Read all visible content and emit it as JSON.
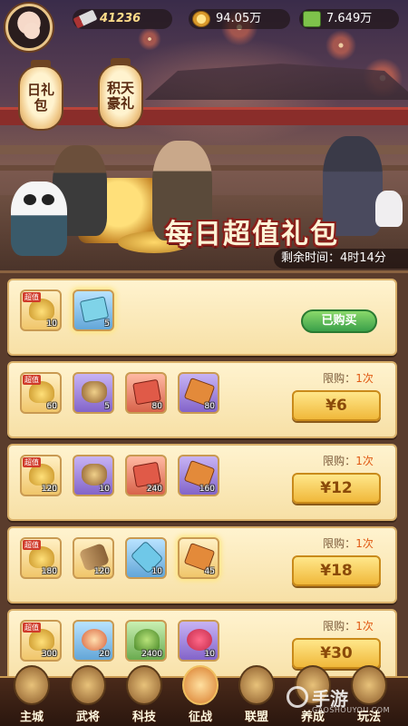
{
  "header": {
    "power": "41236",
    "gold": "94.05万",
    "food": "7.649万"
  },
  "lanterns": [
    {
      "label": "日礼包"
    },
    {
      "label": "积天豪礼"
    }
  ],
  "banner": {
    "title": "每日超值礼包",
    "timer": "剩余时间：4时14分"
  },
  "packages": [
    {
      "items": [
        {
          "icon": "gold-ingot-icon",
          "count": "10",
          "tag": "超值",
          "bg": "gold"
        },
        {
          "icon": "ticket-icon",
          "count": "5",
          "tag": "",
          "bg": "blue"
        }
      ],
      "limit_label": "",
      "limit_num": "",
      "button": "已购买",
      "bought": true
    },
    {
      "items": [
        {
          "icon": "gold-ingot-icon",
          "count": "60",
          "tag": "超值",
          "bg": "gold"
        },
        {
          "icon": "bag-icon",
          "count": "5",
          "tag": "",
          "bg": "purple"
        },
        {
          "icon": "red-envelope-icon",
          "count": "80",
          "tag": "",
          "bg": "red"
        },
        {
          "icon": "scroll-icon",
          "count": "80",
          "tag": "",
          "bg": "purple"
        }
      ],
      "limit_label": "限购：",
      "limit_num": "1次",
      "button": "¥6",
      "bought": false
    },
    {
      "items": [
        {
          "icon": "gold-ingot-icon",
          "count": "120",
          "tag": "超值",
          "bg": "gold"
        },
        {
          "icon": "bag-icon",
          "count": "10",
          "tag": "",
          "bg": "purple"
        },
        {
          "icon": "red-envelope-icon",
          "count": "240",
          "tag": "",
          "bg": "red"
        },
        {
          "icon": "scroll-icon",
          "count": "160",
          "tag": "",
          "bg": "purple"
        }
      ],
      "limit_label": "限购：",
      "limit_num": "1次",
      "button": "¥12",
      "bought": false
    },
    {
      "items": [
        {
          "icon": "gold-ingot-icon",
          "count": "180",
          "tag": "超值",
          "bg": "gold"
        },
        {
          "icon": "barrel-icon",
          "count": "120",
          "tag": "",
          "bg": "gold"
        },
        {
          "icon": "crystal-icon",
          "count": "10",
          "tag": "",
          "bg": "blue"
        },
        {
          "icon": "scroll-icon",
          "count": "45",
          "tag": "",
          "bg": "gold"
        }
      ],
      "limit_label": "限购：",
      "limit_num": "1次",
      "button": "¥18",
      "bought": false
    },
    {
      "items": [
        {
          "icon": "gold-ingot-icon",
          "count": "300",
          "tag": "超值",
          "bg": "gold"
        },
        {
          "icon": "lantern-icon",
          "count": "20",
          "tag": "",
          "bg": "blue"
        },
        {
          "icon": "plant-icon",
          "count": "2400",
          "tag": "",
          "bg": "green"
        },
        {
          "icon": "rose-icon",
          "count": "10",
          "tag": "",
          "bg": "purple"
        }
      ],
      "limit_label": "限购：",
      "limit_num": "1次",
      "button": "¥30",
      "bought": false
    }
  ],
  "nav": [
    {
      "label": "主城",
      "icon": "city-icon"
    },
    {
      "label": "武将",
      "icon": "general-icon"
    },
    {
      "label": "科技",
      "icon": "tech-icon"
    },
    {
      "label": "征战",
      "icon": "battle-icon",
      "active": true
    },
    {
      "label": "联盟",
      "icon": "alliance-icon"
    },
    {
      "label": "养成",
      "icon": "growth-icon"
    },
    {
      "label": "玩法",
      "icon": "gameplay-icon"
    }
  ],
  "watermark": {
    "brand": "手游",
    "sub": "GAOSHOUYOU.COM"
  },
  "colors": {
    "accent": "#f0b83a",
    "bought": "#3aa04a",
    "banner_title_stroke": "#8a1f1a"
  }
}
